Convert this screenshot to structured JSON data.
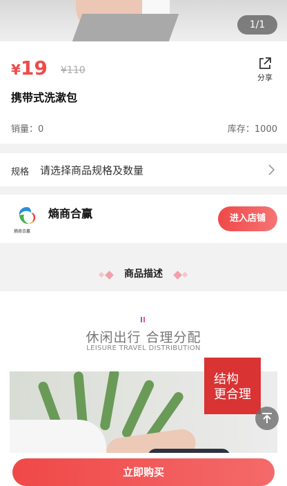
{
  "gallery": {
    "counter": "1/1"
  },
  "product": {
    "currency": "¥",
    "price": "19",
    "original_price": "¥110",
    "title": "携带式洗漱包",
    "sales_label": "销量：0",
    "stock_label": "库存：1000",
    "share_label": "分享"
  },
  "spec": {
    "label": "规格",
    "value": "请选择商品规格及数量"
  },
  "store": {
    "name": "熵商合赢",
    "logo_text": "熵商合赢",
    "enter_label": "进入店铺"
  },
  "description": {
    "heading": "商品描述",
    "banner_cn": "休闲出行 合理分配",
    "banner_en": "LEISURE TRAVEL DISTRIBUTION",
    "badge_line1": "结构",
    "badge_line2": "更合理"
  },
  "actions": {
    "buy_label": "立即购买"
  },
  "colors": {
    "accent": "#f04a4a",
    "badge": "#d93333"
  },
  "icons": [
    "share-icon",
    "chevron-right-icon",
    "store-logo",
    "back-to-top-icon"
  ]
}
